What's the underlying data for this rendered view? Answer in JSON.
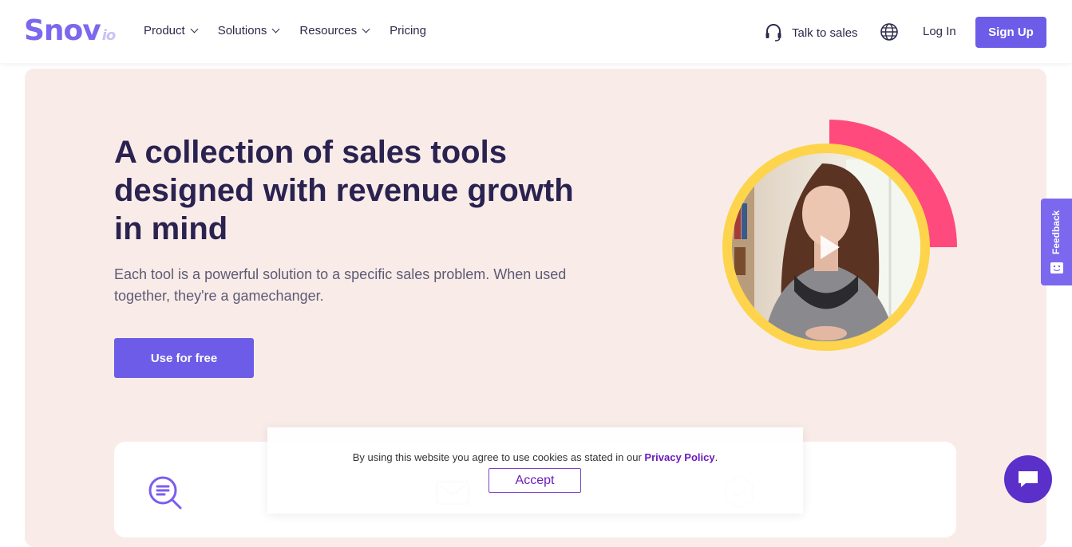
{
  "header": {
    "logo_main": "Snov",
    "logo_suffix": "io",
    "nav": [
      {
        "label": "Product",
        "has_dropdown": true
      },
      {
        "label": "Solutions",
        "has_dropdown": true
      },
      {
        "label": "Resources",
        "has_dropdown": true
      },
      {
        "label": "Pricing",
        "has_dropdown": false
      }
    ],
    "talk_to_sales": "Talk to sales",
    "login": "Log In",
    "signup": "Sign Up"
  },
  "hero": {
    "headline": "A collection of sales tools designed with revenue growth in mind",
    "subtitle": "Each tool is a powerful solution to a specific sales problem. When used together, they're a gamechanger.",
    "cta": "Use for free"
  },
  "cookie_banner": {
    "text": "By using this website you agree to use cookies as stated in our ",
    "link": "Privacy Policy",
    "suffix": ".",
    "accept": "Accept"
  },
  "feedback_tab": "Feedback",
  "colors": {
    "brand": "#6c5ce7",
    "hero_bg": "#f9ece8",
    "ring": "#fdd44b",
    "arc": "#ff4a7d",
    "headline": "#2a2250"
  },
  "icons": [
    "headset-icon",
    "globe-icon",
    "play-icon",
    "search-list-icon",
    "mail-icon",
    "shield-check-icon",
    "chat-icon",
    "feedback-face-icon"
  ]
}
